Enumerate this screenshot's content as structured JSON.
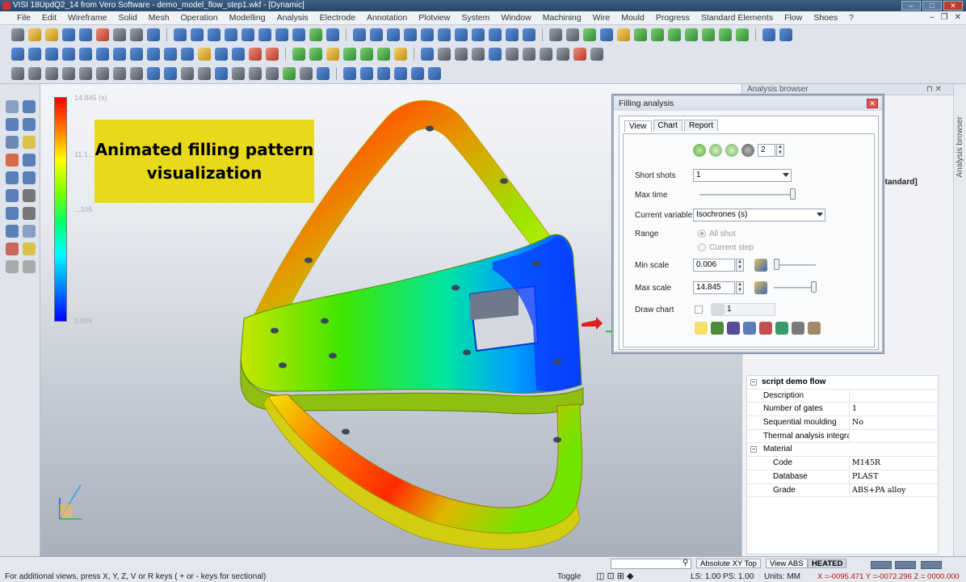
{
  "window": {
    "title": "VISI 18UpdQ2_14 from Vero Software - demo_model_flow_step1.wkf - [Dynamic]"
  },
  "menu": [
    "File",
    "Edit",
    "Wireframe",
    "Solid",
    "Mesh",
    "Operation",
    "Modelling",
    "Analysis",
    "Electrode",
    "Annotation",
    "Plotview",
    "System",
    "Window",
    "Machining",
    "Wire",
    "Mould",
    "Progress",
    "Standard Elements",
    "Flow",
    "Shoes",
    "?"
  ],
  "viewport": {
    "overlay_line1": "Animated filling pattern",
    "overlay_line2": "visualization",
    "scale_max": "14.845 (s)",
    "scale_mid": "11.1...",
    "scale_low": "...105",
    "scale_min": "0.006"
  },
  "browser": {
    "title": "Analysis browser",
    "tab": "Analysis browser",
    "std": "Standard]"
  },
  "props": {
    "group": "script demo flow",
    "rows": [
      {
        "k": "Description",
        "v": ""
      },
      {
        "k": "Number of gates",
        "v": "1"
      },
      {
        "k": "Sequential moulding",
        "v": "No"
      },
      {
        "k": "Thermal analysis integra",
        "v": ""
      }
    ],
    "material_group": "Material",
    "material": [
      {
        "k": "Code",
        "v": "M145R"
      },
      {
        "k": "Database",
        "v": "PLAST"
      },
      {
        "k": "Grade",
        "v": "ABS+PA alloy"
      }
    ]
  },
  "dialog": {
    "title": "Filling analysis",
    "tabs": [
      "View",
      "Chart",
      "Report"
    ],
    "playback_value": "2",
    "short_shots_label": "Short shots",
    "short_shots_value": "1",
    "max_time_label": "Max time",
    "current_variable_label": "Current variable",
    "current_variable_value": "Isochrones (s)",
    "range_label": "Range",
    "range_all": "All shot",
    "range_current": "Current step",
    "min_scale_label": "Min scale",
    "min_scale_value": "0.006",
    "max_scale_label": "Max scale",
    "max_scale_value": "14.845",
    "draw_chart_label": "Draw chart",
    "draw_chart_value": "1"
  },
  "status": {
    "hint": "For additional views, press X, Y, Z, V or R keys ( + or - keys for sectional)",
    "view": "Absolute XY Top",
    "view_abs": "View ABS",
    "heated": "HEATED",
    "toggle": "Toggle",
    "ls": "LS: 1.00 PS: 1.00",
    "units": "Units: MM",
    "coords": "X =-0095.471 Y =-0072.296 Z = 0000.000"
  }
}
